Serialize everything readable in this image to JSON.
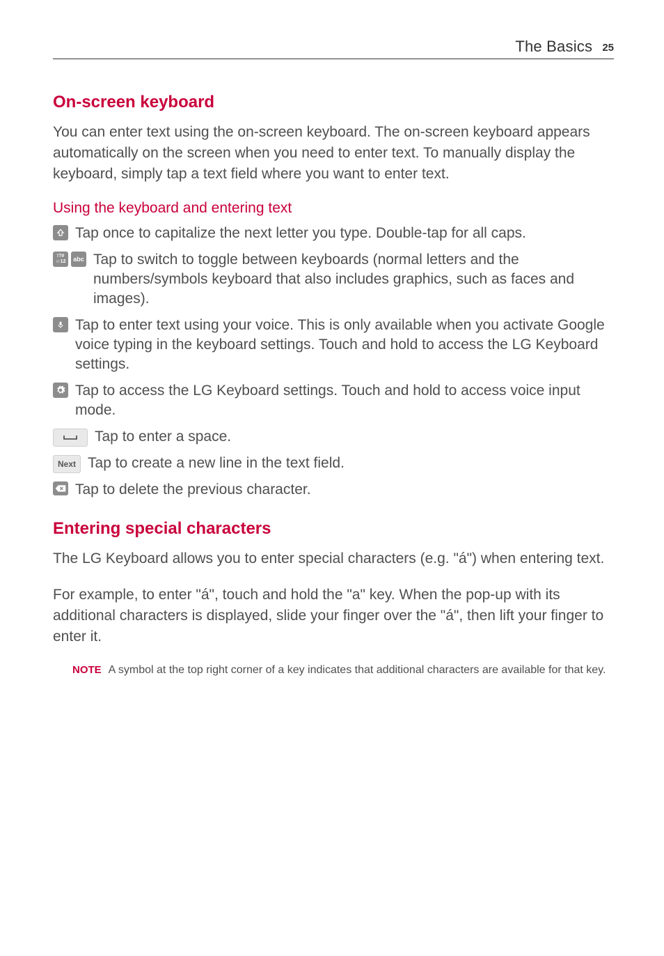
{
  "header": {
    "chapter": "The Basics",
    "page_number": "25"
  },
  "section1": {
    "heading": "On-screen keyboard",
    "intro": "You can enter text using the on-screen keyboard. The on-screen keyboard appears automatically on the screen when you need to enter text. To manually display the keyboard, simply tap a text field where you want to enter text.",
    "subheading": "Using the keyboard and entering text",
    "items": {
      "shift": "Tap once to capitalize the next letter you type. Double-tap for all caps.",
      "toggle": "Tap to switch to toggle between keyboards (normal letters and the numbers/symbols keyboard that also includes graphics, such as faces and images).",
      "voice": "Tap to enter text using your voice. This is only available when you activate Google voice typing in the keyboard settings. Touch and hold to access the LG Keyboard settings.",
      "settings": "Tap to access the LG Keyboard settings. Touch and hold to access voice input mode.",
      "space": "Tap to enter a space.",
      "next": "Tap to create a new line in the text field.",
      "delete": "Tap to delete the previous character."
    },
    "key_labels": {
      "symbols": "!?#",
      "smiley_num": "☺12",
      "abc": "abc",
      "next": "Next"
    }
  },
  "section2": {
    "heading": "Entering special characters",
    "p1": "The LG Keyboard allows you to enter special characters (e.g. \"á\") when entering text.",
    "p2": "For example, to enter \"á\", touch and hold the \"a\" key. When the pop-up with its additional characters is displayed, slide your finger over the \"á\", then lift your finger to enter it.",
    "note_label": "NOTE",
    "note_text": "A symbol at the top right corner of a key indicates that additional characters are available for that key."
  }
}
